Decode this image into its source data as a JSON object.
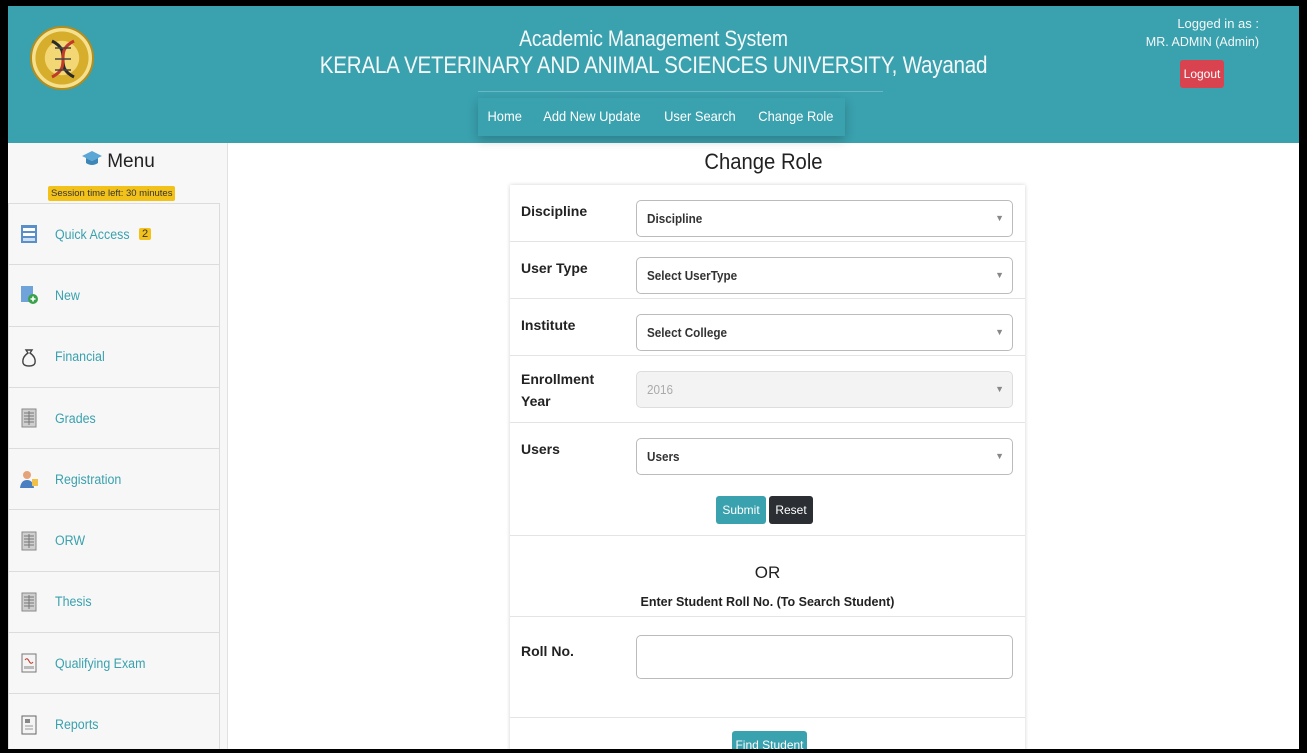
{
  "header": {
    "title_line1": "Academic Management System",
    "title_line2": "KERALA VETERINARY AND ANIMAL SCIENCES UNIVERSITY, Wayanad",
    "logged_in_label": "Logged in as :",
    "logged_in_user": "MR. ADMIN (Admin)",
    "logout_label": "Logout",
    "nav": [
      "Home",
      "Add New Update",
      "User Search",
      "Change Role"
    ],
    "brand_color": "#3aa1ae"
  },
  "sidebar": {
    "title": "Menu",
    "session_text": "Session time left: 30 minutes",
    "items": [
      {
        "label": "Quick Access",
        "badge": "2",
        "icon": "quick-access-icon"
      },
      {
        "label": "New",
        "icon": "new-doc-icon"
      },
      {
        "label": "Financial",
        "icon": "money-bag-icon"
      },
      {
        "label": "Grades",
        "icon": "grades-icon"
      },
      {
        "label": "Registration",
        "icon": "registration-icon"
      },
      {
        "label": "ORW",
        "icon": "orw-icon"
      },
      {
        "label": "Thesis",
        "icon": "thesis-icon"
      },
      {
        "label": "Qualifying Exam",
        "icon": "exam-icon"
      },
      {
        "label": "Reports",
        "icon": "reports-icon"
      }
    ]
  },
  "main": {
    "page_title": "Change Role",
    "form": {
      "discipline_label": "Discipline",
      "discipline_value": "Discipline",
      "usertype_label": "User Type",
      "usertype_value": "Select UserType",
      "institute_label": "Institute",
      "institute_value": "Select College",
      "enrollment_label": "Enrollment Year",
      "enrollment_value": "2016",
      "users_label": "Users",
      "users_value": "Users",
      "submit_label": "Submit",
      "reset_label": "Reset"
    },
    "or_text": "OR",
    "search_help": "Enter Student Roll No. (To Search Student)",
    "roll_label": "Roll No.",
    "roll_value": "",
    "find_label": "Find Student"
  }
}
